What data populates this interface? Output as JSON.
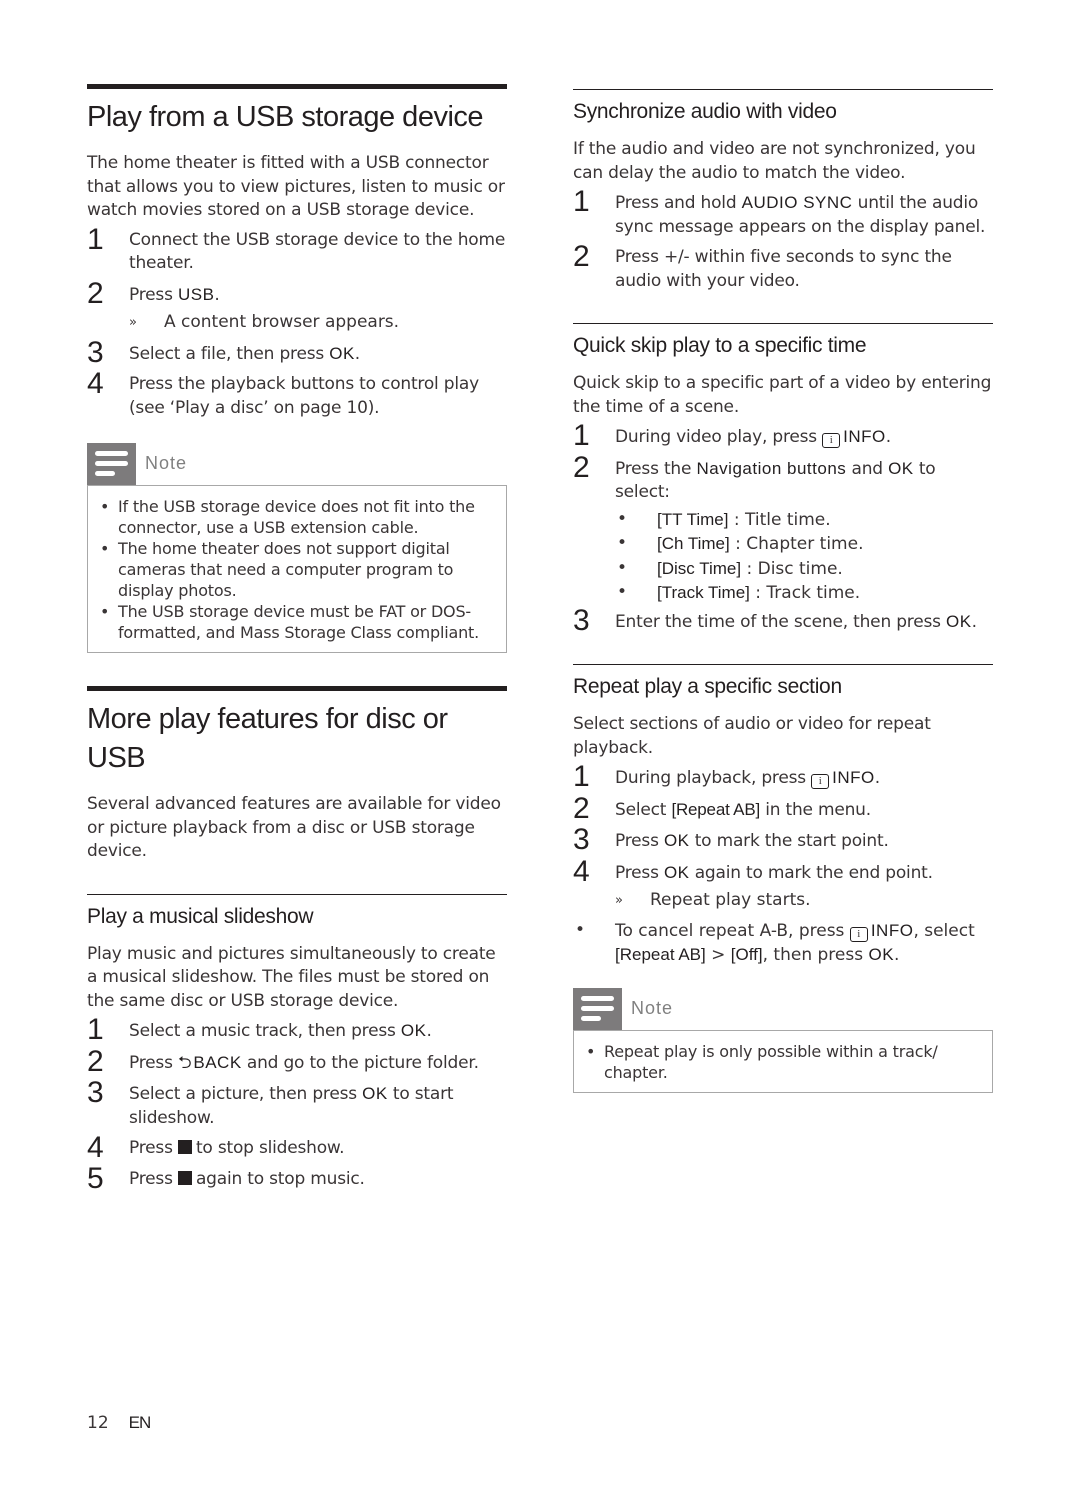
{
  "left": {
    "usb_section": {
      "title": "Play from a USB storage device",
      "intro": "The home theater is fitted with a USB connector that allows you to view pictures, listen to music or watch movies stored on a USB storage device.",
      "steps": [
        {
          "num": "1",
          "text": "Connect the USB storage device to the home theater."
        },
        {
          "num": "2",
          "pre": "Press ",
          "key": "USB",
          "post": ".",
          "result": "A content browser appears."
        },
        {
          "num": "3",
          "pre": "Select a file, then press ",
          "key": "OK",
          "post": "."
        },
        {
          "num": "4",
          "text": "Press the playback buttons to control play (see ‘Play a disc’ on page 10)."
        }
      ],
      "note": {
        "title": "Note",
        "items": [
          "If the USB storage device does not fit into the connector, use a USB extension cable.",
          "The home theater does not support digital cameras that need a computer program to display photos.",
          "The USB storage device must be FAT or DOS-formatted, and Mass Storage Class compliant."
        ]
      }
    },
    "features_section": {
      "title": "More play features for disc or USB",
      "intro": "Several advanced features are available for video or picture playback from a disc or USB storage device."
    },
    "slideshow": {
      "title": "Play a musical slideshow",
      "intro": "Play music and pictures simultaneously to create a musical slideshow. The files must be stored on the same disc or USB storage device.",
      "steps": [
        {
          "num": "1",
          "pre": "Select a music track, then press ",
          "key": "OK",
          "post": "."
        },
        {
          "num": "2",
          "pre": "Press ",
          "icon": "back-icon",
          "key": "BACK",
          "post": " and go to the picture folder."
        },
        {
          "num": "3",
          "pre": "Select a picture, then press ",
          "key": "OK",
          "post": " to start slideshow."
        },
        {
          "num": "4",
          "pre": "Press ",
          "icon": "stop-icon",
          "post": "to stop slideshow."
        },
        {
          "num": "5",
          "pre": "Press ",
          "icon": "stop-icon",
          "post": "again to stop music."
        }
      ]
    }
  },
  "right": {
    "sync": {
      "title": "Synchronize audio with video",
      "intro": "If the audio and video are not synchronized, you can delay the audio to match the video.",
      "steps": [
        {
          "num": "1",
          "pre": "Press and hold ",
          "key": "AUDIO SYNC",
          "post": " until the audio sync message appears on the display panel."
        },
        {
          "num": "2",
          "text": "Press +/- within five seconds to sync the audio with your video."
        }
      ]
    },
    "quick_skip": {
      "title": "Quick skip play to a specific time",
      "intro": "Quick skip to a specific part of a video by entering the time of a scene.",
      "steps": [
        {
          "num": "1",
          "pre": "During video play, press ",
          "icon": "info-icon",
          "key": "INFO",
          "post": "."
        },
        {
          "num": "2",
          "pre": "Press the ",
          "key": "Navigation buttons",
          "mid": " and ",
          "key2": "OK",
          "post": " to select:"
        },
        {
          "num": "3",
          "pre": "Enter the time of the scene, then press ",
          "key": "OK",
          "post": "."
        }
      ],
      "options": [
        {
          "menu": "[TT Time]",
          "desc": " : Title time."
        },
        {
          "menu": "[Ch Time]",
          "desc": " : Chapter time."
        },
        {
          "menu": "[Disc Time]",
          "desc": " : Disc time."
        },
        {
          "menu": "[Track Time]",
          "desc": " : Track time."
        }
      ]
    },
    "repeat": {
      "title": "Repeat play a specific section",
      "intro": "Select sections of audio or video for repeat playback.",
      "steps": [
        {
          "num": "1",
          "pre": "During playback, press ",
          "icon": "info-icon",
          "key": "INFO",
          "post": "."
        },
        {
          "num": "2",
          "pre": "Select ",
          "menu": "[Repeat AB]",
          "post": " in the menu."
        },
        {
          "num": "3",
          "pre": "Press ",
          "key": "OK",
          "post": " to mark the start point."
        },
        {
          "num": "4",
          "pre": "Press ",
          "key": "OK",
          "post": " again to mark the end point.",
          "result": "Repeat play starts."
        }
      ],
      "cancel": {
        "pre": "To cancel repeat A-B, press ",
        "key": "INFO",
        "mid": ", select ",
        "menu1": "[Repeat AB]",
        "sep": " > ",
        "menu2": "[Off]",
        "mid2": ", then press ",
        "key2": "OK",
        "post": "."
      },
      "note": {
        "title": "Note",
        "items": [
          "Repeat play is only possible within a track/ chapter."
        ]
      }
    }
  },
  "footer": {
    "page_number": "12",
    "language": "EN"
  }
}
